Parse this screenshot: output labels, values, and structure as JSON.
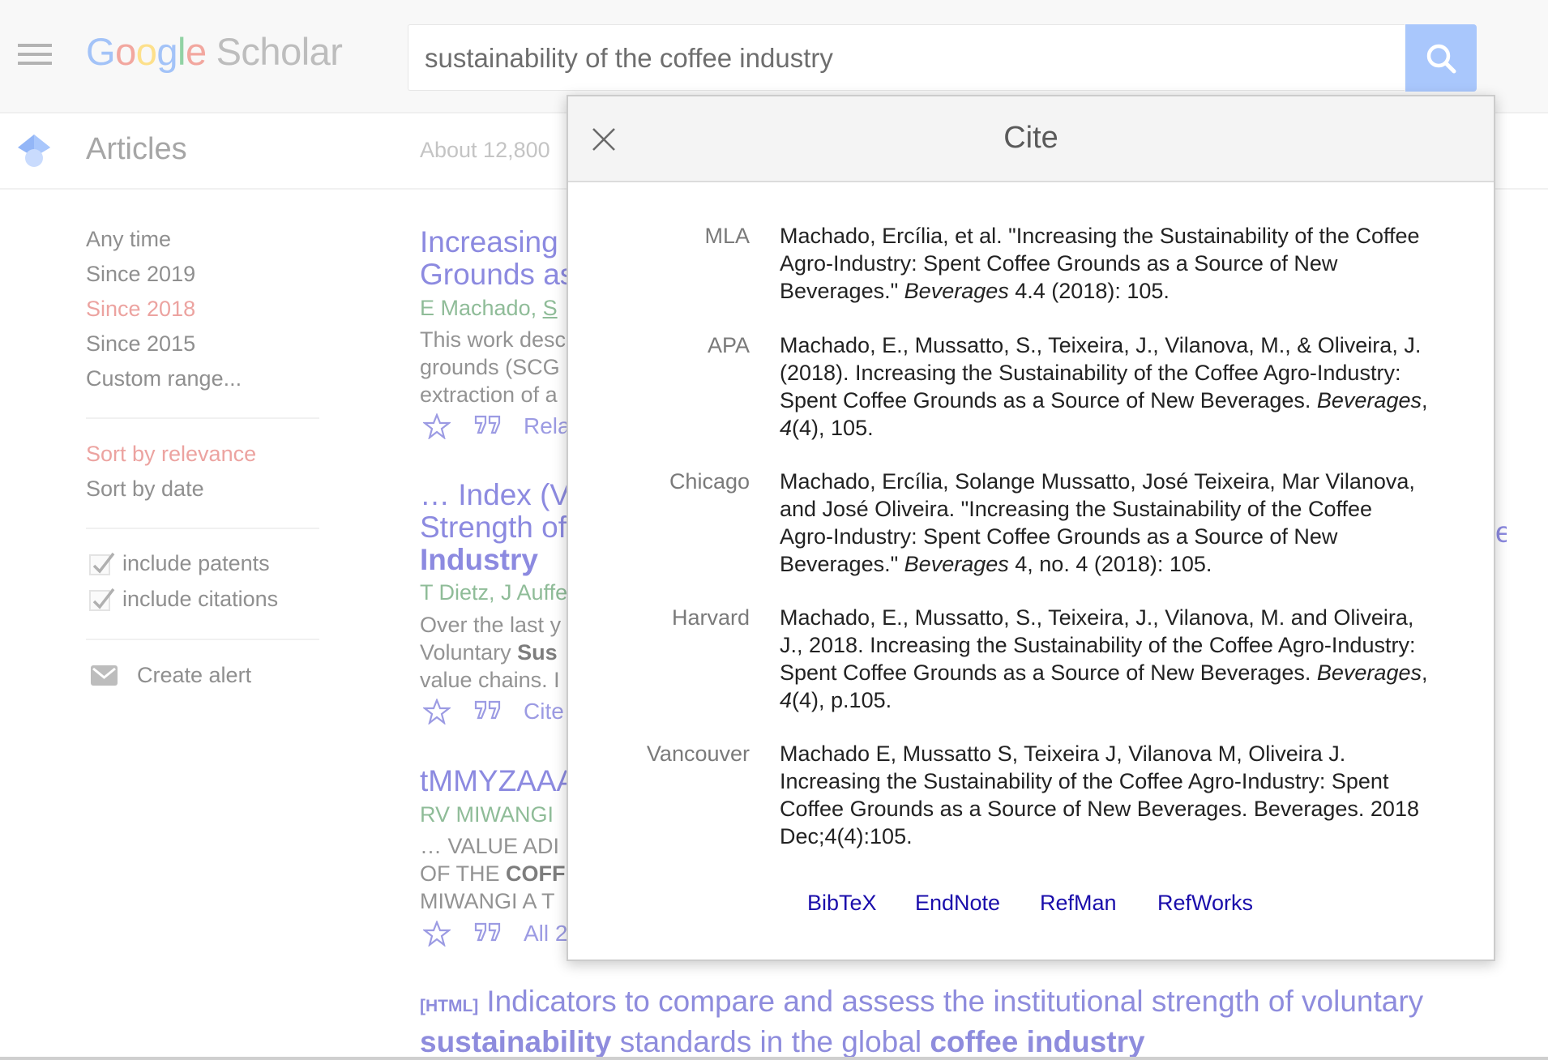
{
  "header": {
    "logo_google": [
      "G",
      "o",
      "o",
      "g",
      "l",
      "e"
    ],
    "logo_scholar": "Scholar",
    "search_value": "sustainability of the coffee industry",
    "menu_icon": "hamburger-menu-icon",
    "search_icon": "magnifier-icon"
  },
  "subheader": {
    "section_label": "Articles",
    "result_count_partial": "About 12,800"
  },
  "sidebar": {
    "time_filters": [
      {
        "label": "Any time",
        "active": false
      },
      {
        "label": "Since 2019",
        "active": false
      },
      {
        "label": "Since 2018",
        "active": true
      },
      {
        "label": "Since 2015",
        "active": false
      },
      {
        "label": "Custom range...",
        "active": false
      }
    ],
    "sort_options": [
      {
        "label": "Sort by relevance",
        "active": true
      },
      {
        "label": "Sort by date",
        "active": false
      }
    ],
    "checkboxes": [
      {
        "label": "include patents",
        "checked": true
      },
      {
        "label": "include citations",
        "checked": true
      }
    ],
    "create_alert": "Create alert"
  },
  "results": [
    {
      "title_lines": [
        "Increasing",
        "Grounds as"
      ],
      "authors_plain": "E Machado, ",
      "authors_link": "S",
      "snippet_lines": [
        "This work desc",
        "grounds (SCG",
        "extraction of a"
      ],
      "action_link": "Rela"
    },
    {
      "title_lines": [
        "… Index (V",
        "Strength of"
      ],
      "title_bold_line": "Industry",
      "authors_plain": "T Dietz, J Auffe",
      "snippet_lines": [
        "Over the last y"
      ],
      "snippet_line2_plain": "Voluntary ",
      "snippet_line2_bold": "Sus",
      "snippet_line3": "value chains. I",
      "action_link": "Cite"
    },
    {
      "title_lines": [
        "tMMYZAAA"
      ],
      "authors_plain": "RV MIWANGI",
      "snippet_lines": [
        "… VALUE ADI"
      ],
      "snippet_line2_plain": "OF THE ",
      "snippet_line2_bold": "COFF",
      "snippet_line3": "MIWANGI A T",
      "action_link": "All 2"
    }
  ],
  "bottom_result": {
    "tag": "[HTML]",
    "title_part1": "Indicators to compare and assess the institutional strength of voluntary",
    "title_bold1": "sustainability",
    "title_part2": " standards in the global ",
    "title_bold2": "coffee industry"
  },
  "peek_text": "e",
  "cite_modal": {
    "title": "Cite",
    "close_icon": "close-x-icon",
    "citations": [
      {
        "style": "MLA",
        "pre": "Machado, Ercília, et al. \"Increasing the Sustainability of the Coffee Agro-Industry: Spent Coffee Grounds as a Source of New Beverages.\" ",
        "italic": "Beverages",
        "post": " 4.4 (2018): 105."
      },
      {
        "style": "APA",
        "pre": "Machado, E., Mussatto, S., Teixeira, J., Vilanova, M., & Oliveira, J. (2018). Increasing the Sustainability of the Coffee Agro-Industry: Spent Coffee Grounds as a Source of New Beverages. ",
        "italic": "Beverages",
        "mid": ", ",
        "italic2": "4",
        "post": "(4), 105."
      },
      {
        "style": "Chicago",
        "pre": "Machado, Ercília, Solange Mussatto, José Teixeira, Mar Vilanova, and José Oliveira. \"Increasing the Sustainability of the Coffee Agro-Industry: Spent Coffee Grounds as a Source of New Beverages.\" ",
        "italic": "Beverages",
        "post": " 4, no. 4 (2018): 105."
      },
      {
        "style": "Harvard",
        "pre": "Machado, E., Mussatto, S., Teixeira, J., Vilanova, M. and Oliveira, J., 2018. Increasing the Sustainability of the Coffee Agro-Industry: Spent Coffee Grounds as a Source of New Beverages. ",
        "italic": "Beverages",
        "mid": ", ",
        "italic2": "4",
        "post": "(4), p.105."
      },
      {
        "style": "Vancouver",
        "pre": "Machado E, Mussatto S, Teixeira J, Vilanova M, Oliveira J. Increasing the Sustainability of the Coffee Agro-Industry: Spent Coffee Grounds as a Source of New Beverages. Beverages. 2018 Dec;4(4):105.",
        "italic": "",
        "post": ""
      }
    ],
    "export_links": [
      "BibTeX",
      "EndNote",
      "RefMan",
      "RefWorks"
    ]
  },
  "colors": {
    "link_faded": "#8c8ae0",
    "active_filter": "#eca3a0",
    "author_green": "#8fbc98",
    "export_link": "#1a0dab",
    "search_button": "#a9c7fc"
  }
}
